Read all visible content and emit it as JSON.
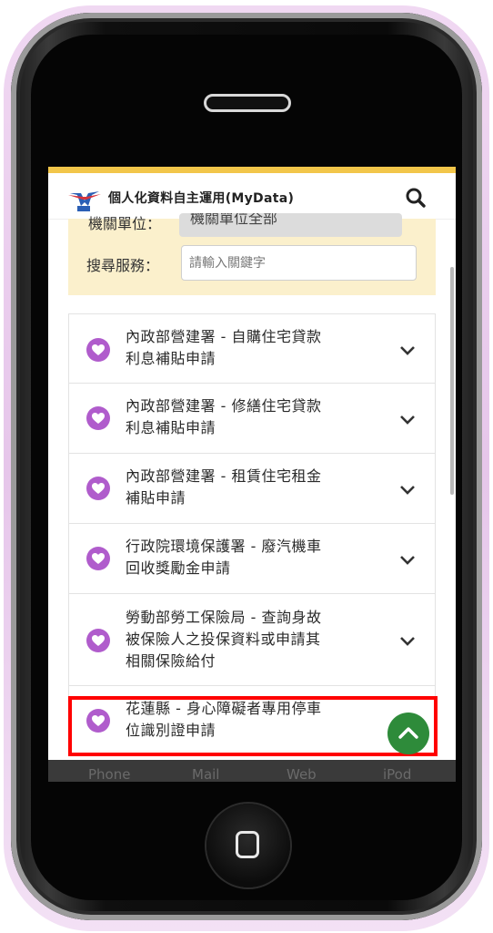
{
  "header": {
    "app_title": "個人化資料自主運用(MyData)"
  },
  "filter": {
    "agency_label": "機關單位：",
    "agency_value": "機關單位全部",
    "search_label": "搜尋服務：",
    "search_placeholder": "請輸入關鍵字"
  },
  "services": [
    {
      "line1": "內政部營建署 - 自購住宅貸款",
      "line2": "利息補貼申請"
    },
    {
      "line1": "內政部營建署 - 修繕住宅貸款",
      "line2": "利息補貼申請"
    },
    {
      "line1": "內政部營建署 - 租賃住宅租金",
      "line2": "補貼申請"
    },
    {
      "line1": "行政院環境保護署 - 廢汽機車",
      "line2": "回收獎勵金申請"
    },
    {
      "line1": "勞動部勞工保險局 - 查詢身故",
      "line2": "被保險人之投保資料或申請其",
      "line3": "相關保險給付"
    },
    {
      "line1": "花蓮縣 - 身心障礙者專用停車",
      "line2": "位識別證申請"
    }
  ],
  "dock": {
    "phone": "Phone",
    "mail": "Mail",
    "web": "Web",
    "ipod": "iPod"
  },
  "colors": {
    "accent_bar": "#f2c64a",
    "panel_bg": "#fbf0cc",
    "service_icon": "#b05ccc",
    "fab": "#2e8b3a",
    "highlight": "#ff0000"
  }
}
